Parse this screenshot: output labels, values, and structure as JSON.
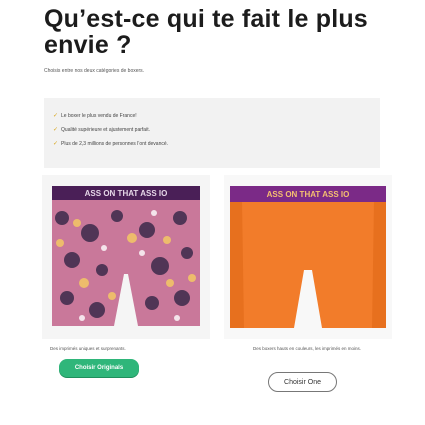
{
  "page": {
    "title": "Qu’est-ce qui te fait le plus envie ?",
    "subtitle": "Choisis entre nos deux catégories de boxers."
  },
  "features": [
    "Le boxer le plus vendu de France!",
    "Qualité supérieure et ajustement parfait.",
    "Plus de 2,3 millions de personnes l’ont devancé."
  ],
  "products": {
    "originals": {
      "waistband_text": "ASS ON THAT ASS IO",
      "description": "Des imprimés uniques et surprenants.",
      "button": "Choisir Originals"
    },
    "one": {
      "waistband_text": "ASS ON THAT ASS IO",
      "description": "Des boxers hauts en couleurs, les imprimés en moins.",
      "button": "Choisir One"
    }
  },
  "colors": {
    "accent_green": "#2fb67a",
    "check_gold": "#d7a416",
    "boxer_orange": "#f27c2a",
    "waistband_purple": "#7b2a87",
    "print_pink": "#c9789a"
  }
}
